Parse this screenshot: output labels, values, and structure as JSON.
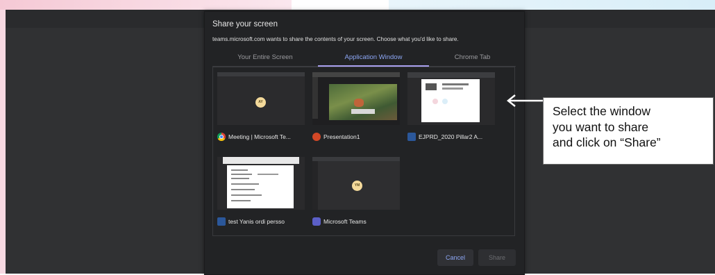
{
  "dialog": {
    "title": "Share your screen",
    "subtitle": "teams.microsoft.com wants to share the contents of your screen. Choose what you'd like to share.",
    "tabs": [
      {
        "label": "Your Entire Screen",
        "active": false
      },
      {
        "label": "Application Window",
        "active": true
      },
      {
        "label": "Chrome Tab",
        "active": false
      }
    ],
    "windows": [
      {
        "label": "Meeting | Microsoft Te...",
        "icon": "chrome-icon",
        "avatar": "AY"
      },
      {
        "label": "Presentation1",
        "icon": "powerpoint-icon"
      },
      {
        "label": "EJPRD_2020 Pillar2 A...",
        "icon": "word-icon"
      },
      {
        "label": "test Yanis ordi persso",
        "icon": "word-icon"
      },
      {
        "label": "Microsoft Teams",
        "icon": "teams-icon",
        "avatar": "YM"
      }
    ],
    "cancel_label": "Cancel",
    "share_label": "Share"
  },
  "callout": {
    "lines": [
      "Select the window",
      "you want to share",
      "and click on “Share”"
    ]
  },
  "colors": {
    "dialog_bg": "#222325",
    "accent": "#8da7f5",
    "tab_indicator": "#a9a0ef"
  }
}
